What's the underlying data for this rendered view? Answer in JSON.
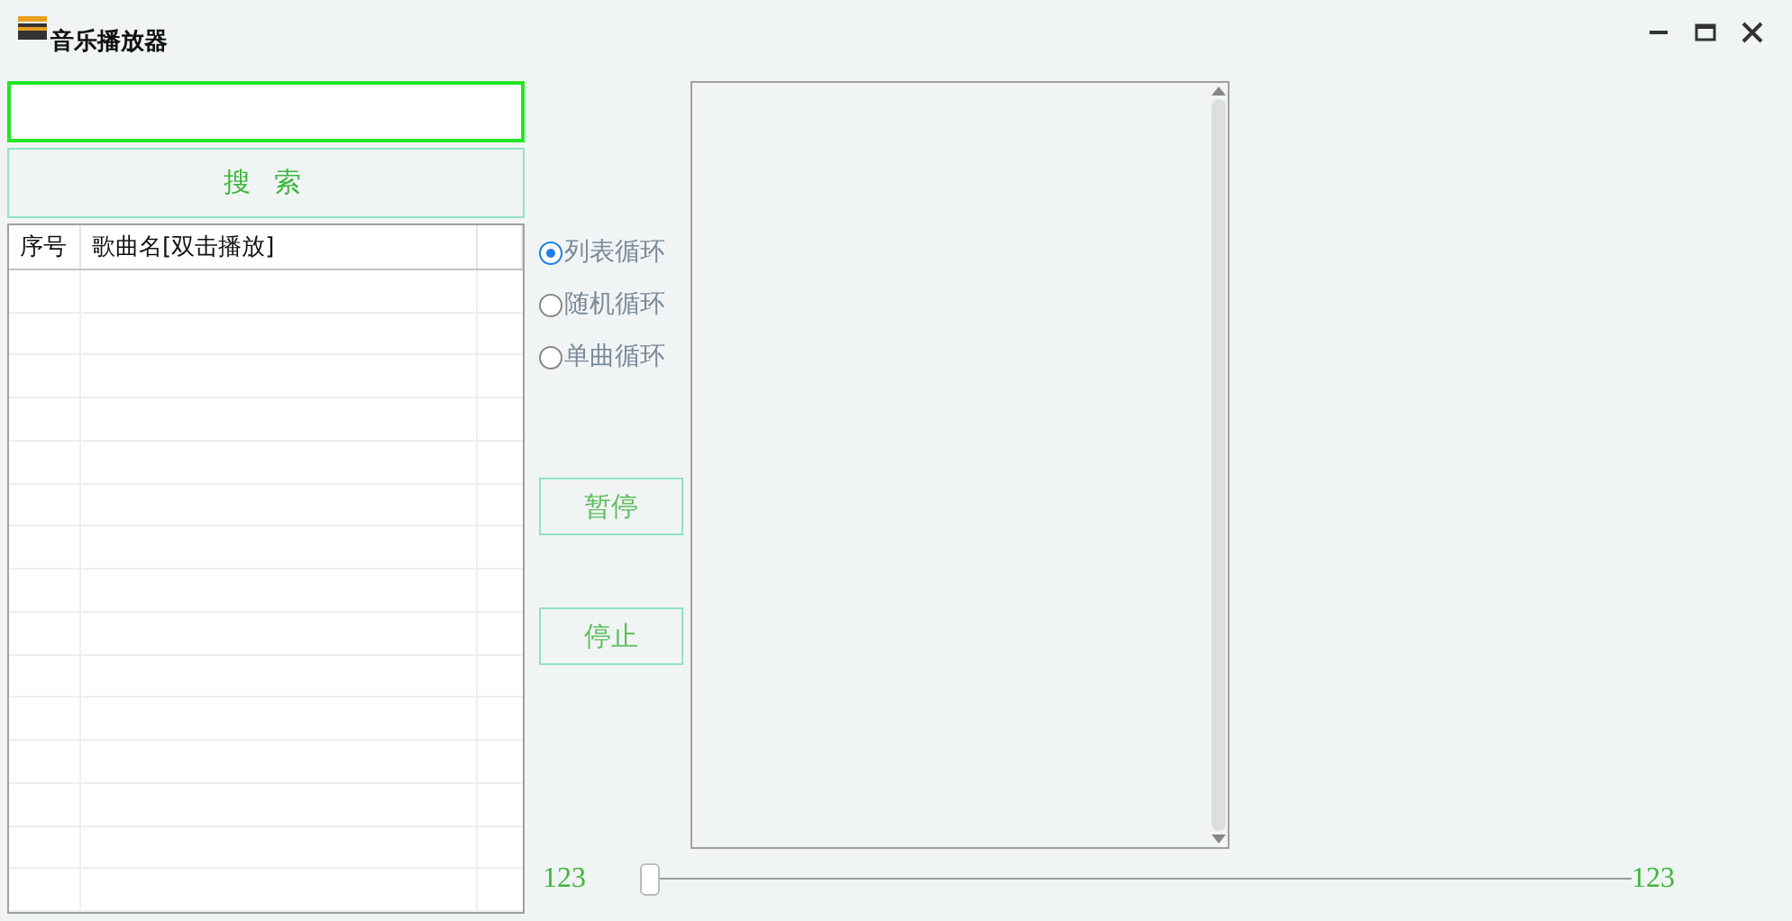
{
  "window": {
    "title": "音乐播放器"
  },
  "search_button": "搜 索",
  "table": {
    "columns": [
      "序号",
      "歌曲名[双击播放]"
    ]
  },
  "play_modes": [
    {
      "label": "列表循环",
      "selected": true
    },
    {
      "label": "随机循环",
      "selected": false
    },
    {
      "label": "单曲循环",
      "selected": false
    }
  ],
  "buttons": [
    "暂停",
    "停止"
  ],
  "progress": {
    "start": "123",
    "end": "123",
    "level": 0
  }
}
